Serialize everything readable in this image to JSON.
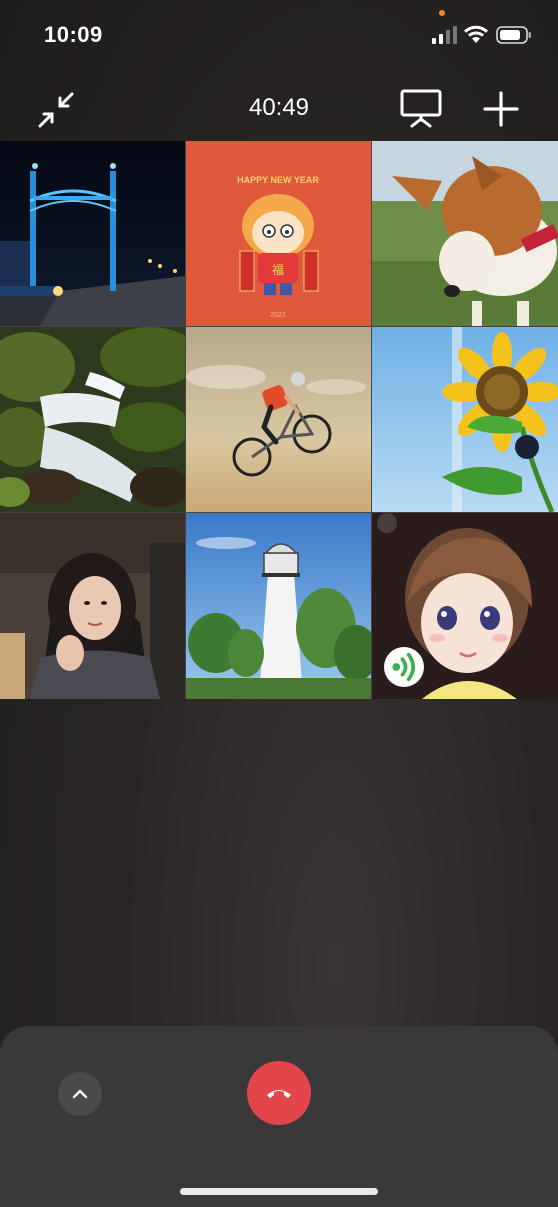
{
  "status_bar": {
    "time": "10:09",
    "icons": [
      "cellular-signal-icon",
      "wifi-icon",
      "battery-icon"
    ],
    "indicator_color": "#f0882d"
  },
  "call": {
    "duration": "40:49",
    "toolbar_icons": [
      "minimize-icon",
      "screen-share-icon",
      "add-participant-icon"
    ]
  },
  "participants": [
    {
      "tile": "bridge-night"
    },
    {
      "tile": "cartoon-tiger-girl",
      "caption": "HAPPY NEW YEAR",
      "sticker_char": "福",
      "year": "2022"
    },
    {
      "tile": "corgi-dog"
    },
    {
      "tile": "waterfall"
    },
    {
      "tile": "bmx-rider"
    },
    {
      "tile": "sunflower"
    },
    {
      "tile": "woman-selfie"
    },
    {
      "tile": "lighthouse"
    },
    {
      "tile": "anime-avatar",
      "speaking": true
    }
  ],
  "controls": {
    "expand_icon": "chevron-up-icon",
    "hangup_icon": "phone-hangup-icon",
    "hangup_color": "#e2464a"
  }
}
